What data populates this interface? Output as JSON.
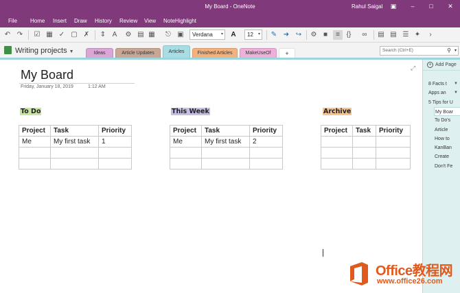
{
  "window": {
    "title": "My Board  -  OneNote",
    "user": "Rahul Saigal"
  },
  "menu": [
    "File",
    "Home",
    "Insert",
    "Draw",
    "History",
    "Review",
    "View",
    "NoteHighlight"
  ],
  "toolbar": {
    "font_name": "Verdana",
    "font_size": "12"
  },
  "notebook": {
    "name": "Writing projects",
    "sections": [
      {
        "label": "Ideas",
        "color": "#d9a6d6"
      },
      {
        "label": "Article Updates",
        "color": "#c9a796"
      },
      {
        "label": "Articles",
        "color": "#a8dde3",
        "active": true
      },
      {
        "label": "Finished Articles",
        "color": "#f2b27f"
      },
      {
        "label": "MakeUseOf",
        "color": "#ecb0d9"
      },
      {
        "label": "+",
        "color": "#ffffff"
      }
    ],
    "search_placeholder": "Search (Ctrl+E)"
  },
  "page": {
    "title": "My Board",
    "date": "Friday, January 18, 2019",
    "time": "1:12 AM",
    "columns": [
      {
        "heading": "To Do",
        "highlight": "#c8e6a0",
        "headers": [
          "Project",
          "Task",
          "Priority"
        ],
        "rows": [
          [
            "Me",
            "My first task",
            "1"
          ],
          [
            "",
            "",
            ""
          ],
          [
            "",
            "",
            ""
          ]
        ]
      },
      {
        "heading": "This Week",
        "highlight": "#c7bde6",
        "headers": [
          "Project",
          "Task",
          "Priority"
        ],
        "rows": [
          [
            "Me",
            "My first task",
            "2"
          ],
          [
            "",
            "",
            ""
          ],
          [
            "",
            "",
            ""
          ]
        ]
      },
      {
        "heading": "Archive",
        "highlight": "#f6c391",
        "headers": [
          "Project",
          "Task",
          "Priority"
        ],
        "rows": [
          [
            "",
            "",
            ""
          ],
          [
            "",
            "",
            ""
          ],
          [
            "",
            "",
            ""
          ]
        ]
      }
    ]
  },
  "page_list": {
    "add_label": "Add Page",
    "pages": [
      {
        "label": "8 Facts t",
        "caret": true,
        "indent": false
      },
      {
        "label": "Apps an",
        "caret": true,
        "indent": false
      },
      {
        "label": "5 Tips for U",
        "caret": false,
        "indent": false
      },
      {
        "label": "My Boar",
        "caret": false,
        "indent": true,
        "selected": true
      },
      {
        "label": "To Do's",
        "caret": false,
        "indent": true
      },
      {
        "label": "Article",
        "caret": false,
        "indent": true
      },
      {
        "label": "How to",
        "caret": false,
        "indent": true
      },
      {
        "label": "KanBan",
        "caret": false,
        "indent": true
      },
      {
        "label": "Create",
        "caret": false,
        "indent": true
      },
      {
        "label": "Don't Fe",
        "caret": false,
        "indent": true
      }
    ]
  },
  "watermark": {
    "brand": "Office教程网",
    "url": "www.office26.com"
  }
}
